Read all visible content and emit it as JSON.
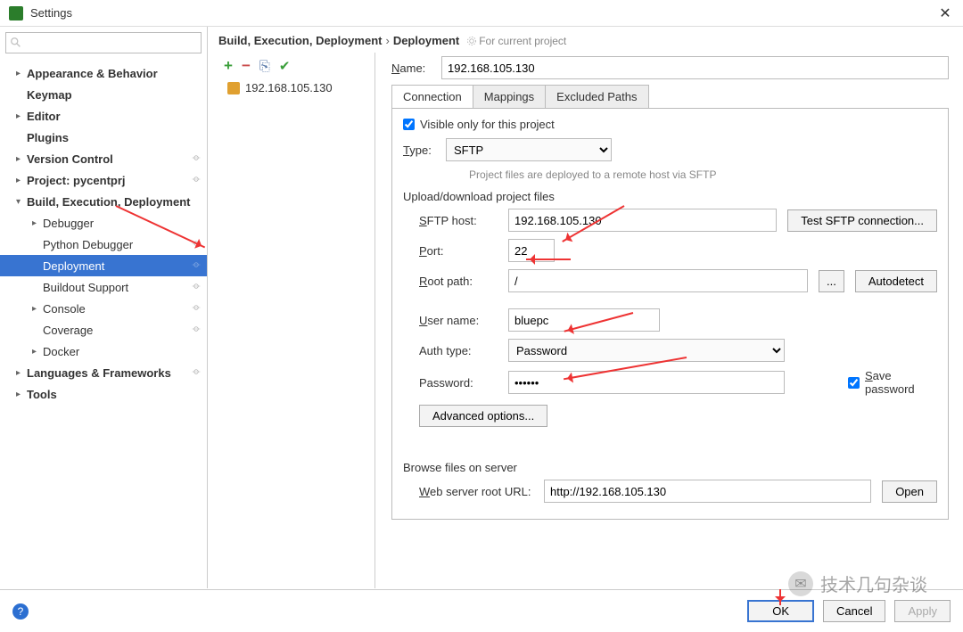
{
  "window": {
    "title": "Settings"
  },
  "sidebar": {
    "search_placeholder": "",
    "items": [
      {
        "label": "Appearance & Behavior",
        "bold": true,
        "expandable": true
      },
      {
        "label": "Keymap",
        "bold": true
      },
      {
        "label": "Editor",
        "bold": true,
        "expandable": true
      },
      {
        "label": "Plugins",
        "bold": true
      },
      {
        "label": "Version Control",
        "bold": true,
        "expandable": true,
        "gear": true
      },
      {
        "label": "Project: pycentprj",
        "bold": true,
        "expandable": true,
        "gear": true
      },
      {
        "label": "Build, Execution, Deployment",
        "bold": true,
        "expandable": true,
        "expanded": true
      },
      {
        "label": "Debugger",
        "lvl": 2,
        "expandable": true
      },
      {
        "label": "Python Debugger",
        "lvl": 2,
        "gear": true
      },
      {
        "label": "Deployment",
        "lvl": 2,
        "selected": true,
        "gear": true
      },
      {
        "label": "Buildout Support",
        "lvl": 2,
        "gear": true
      },
      {
        "label": "Console",
        "lvl": 2,
        "expandable": true,
        "gear": true
      },
      {
        "label": "Coverage",
        "lvl": 2,
        "gear": true
      },
      {
        "label": "Docker",
        "lvl": 2,
        "expandable": true
      },
      {
        "label": "Languages & Frameworks",
        "bold": true,
        "expandable": true,
        "gear": true
      },
      {
        "label": "Tools",
        "bold": true,
        "expandable": true
      }
    ]
  },
  "breadcrumb": {
    "part1": "Build, Execution, Deployment",
    "part2": "Deployment",
    "project_note": "For current project"
  },
  "server_list": {
    "items": [
      "192.168.105.130"
    ]
  },
  "form": {
    "name_label": "Name:",
    "name_value": "192.168.105.130",
    "tabs": [
      "Connection",
      "Mappings",
      "Excluded Paths"
    ],
    "active_tab": 0,
    "visible_only_label": "Visible only for this project",
    "visible_only_checked": true,
    "type_label": "Type:",
    "type_value": "SFTP",
    "type_help": "Project files are deployed to a remote host via SFTP",
    "upload_section": "Upload/download project files",
    "sftp_host_label": "SFTP host:",
    "sftp_host_value": "192.168.105.130",
    "test_btn": "Test SFTP connection...",
    "port_label": "Port:",
    "port_value": "22",
    "root_label": "Root path:",
    "root_value": "/",
    "browse_btn": "...",
    "autodetect_btn": "Autodetect",
    "user_label": "User name:",
    "user_value": "bluepc",
    "auth_label": "Auth type:",
    "auth_value": "Password",
    "password_label": "Password:",
    "password_value": "••••••",
    "save_pw_label": "Save password",
    "save_pw_checked": true,
    "advanced_btn": "Advanced options...",
    "browse_section": "Browse files on server",
    "web_url_label": "Web server root URL:",
    "web_url_value": "http://192.168.105.130",
    "open_btn": "Open"
  },
  "buttons": {
    "ok": "OK",
    "cancel": "Cancel",
    "apply": "Apply"
  },
  "watermark": "技术几句杂谈"
}
